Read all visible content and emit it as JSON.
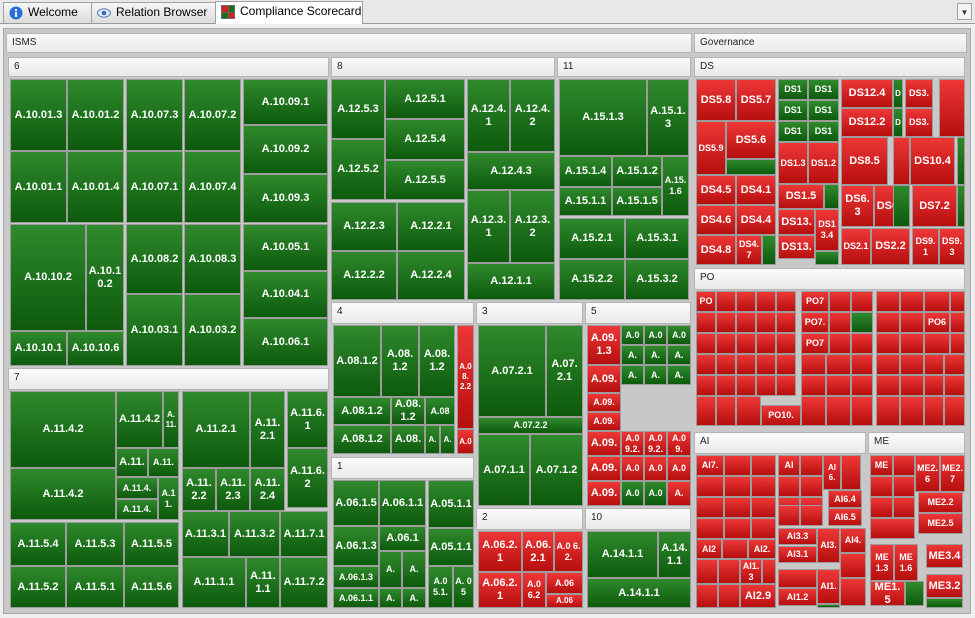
{
  "tabs": [
    {
      "label": "Welcome",
      "icon": "info-icon"
    },
    {
      "label": "Relation Browser",
      "icon": "eye-icon"
    },
    {
      "label": "Compliance Scorecard",
      "icon": "treemap-icon",
      "active": true
    }
  ],
  "colors": {
    "compliant": "#1a6e1a",
    "noncompliant": "#d42020"
  },
  "treemap": {
    "sections": [
      {
        "key": "isms",
        "label": "ISMS"
      },
      {
        "key": "governance",
        "label": "Governance"
      }
    ],
    "groups": {
      "g6": "6",
      "g8": "8",
      "g11": "11",
      "g4": "4",
      "g3": "3",
      "g5": "5",
      "g7": "7",
      "g1": "1",
      "g2": "2",
      "g10": "10",
      "gds": "DS",
      "gpo": "PO",
      "gai": "AI",
      "gme": "ME"
    },
    "cells": {
      "c6_01": "A.10.01.3",
      "c6_02": "A.10.01.2",
      "c6_03": "A.10.07.3",
      "c6_04": "A.10.07.2",
      "c6_05": "A.10.09.1",
      "c6_06": "A.10.01.1",
      "c6_07": "A.10.01.4",
      "c6_08": "A.10.07.1",
      "c6_09": "A.10.07.4",
      "c6_10": "A.10.09.2",
      "c6_11": "A.10.09.3",
      "c6_12": "A.10.10.2",
      "c6_13": "A.10.10.2",
      "c6_14": "A.10.08.2",
      "c6_15": "A.10.08.3",
      "c6_16": "A.10.05.1",
      "c6_17": "A.10.04.1",
      "c6_18": "A.10.10.1",
      "c6_19": "A.10.10.6",
      "c6_20": "A.10.03.1",
      "c6_21": "A.10.03.2",
      "c6_22": "A.10.06.1",
      "c8_01": "A.12.5.3",
      "c8_02": "A.12.5.1",
      "c8_03": "A.12.4.1",
      "c8_04": "A.12.4.2",
      "c8_05": "A.12.5.4",
      "c8_06": "A.12.5.2",
      "c8_07": "A.12.5.5",
      "c8_08": "A.12.4.3",
      "c8_09": "A.12.3.1",
      "c8_10": "A.12.3.2",
      "c8_11": "A.12.2.3",
      "c8_12": "A.12.2.1",
      "c8_13": "A.12.2.2",
      "c8_14": "A.12.2.4",
      "c8_15": "A.12.1.1",
      "c11_01": "A.15.1.3",
      "c11_02": "A.15.1.3",
      "c11_03": "A.15.1.4",
      "c11_04": "A.15.1.2",
      "c11_05": "A.15.1.6",
      "c11_06": "A.15.1.1",
      "c11_07": "A.15.1.5",
      "c11_08": "A.15.2.1",
      "c11_09": "A.15.3.1",
      "c11_10": "A.15.2.2",
      "c11_11": "A.15.3.2",
      "c7_01": "A.11.4.2",
      "c7_02": "A.11.4.2",
      "c7_03": "A.11.",
      "c7_04": "A.11.2.1",
      "c7_05": "A.11.2.1",
      "c7_06": "A.11.6.1",
      "c7_07": "A.11.",
      "c7_08": "A.11.",
      "c7_09": "A.11.4.2",
      "c7_10": "A.11.4.",
      "c7_11": "A.11.",
      "c7_12": "A.11.4.",
      "c7_13": "A.11.2.2",
      "c7_14": "A.11.2.3",
      "c7_15": "A.11.2.4",
      "c7_16": "A.11.6.2",
      "c7_17": "A.11.5.4",
      "c7_18": "A.11.5.3",
      "c7_19": "A.11.5.5",
      "c7_20": "A.11.3.1",
      "c7_21": "A.11.3.2",
      "c7_22": "A.11.7.1",
      "c7_23": "A.11.5.2",
      "c7_24": "A.11.5.1",
      "c7_25": "A.11.5.6",
      "c7_26": "A.11.1.1",
      "c7_27": "A.11.1.1",
      "c7_28": "A.11.7.2",
      "c4_01": "A.08.1.2",
      "c4_02": "A.08.1.2",
      "c4_03": "A.08.1.2",
      "c4_04": "A.08.2.2",
      "c4_05": "A.08.1.2",
      "c4_06": "A.08.1.2",
      "c4_07": "A.08",
      "c4_08": "A.08.1.2",
      "c4_09": "A.08.",
      "c4_10": "A.",
      "c4_11": "A.",
      "c4_12": "A.0",
      "c3_01": "A.07.2.1",
      "c3_02": "A.07.2.1",
      "c3_03": "A.07.2.2",
      "c3_04": "A.07.1.1",
      "c3_05": "A.07.1.2",
      "c5_01": "A.09.1.3",
      "c5_02": "A.0",
      "c5_03": "A.0",
      "c5_04": "A.0",
      "c5_05": "A.09.",
      "c5_06": "A.",
      "c5_07": "A.",
      "c5_08": "A.",
      "c5_09": "A.09.",
      "c5_10": "A.",
      "c5_11": "A.",
      "c5_12": "A.",
      "c5_13": "A.09.",
      "c5_14": "A.09.",
      "c5_15": "A.09.2.",
      "c5_16": "A.09.2.",
      "c5_17": "A.09.",
      "c5_18": "A.09.",
      "c5_19": "A.0",
      "c5_20": "A.0",
      "c5_21": "A.0",
      "c5_22": "A.09.",
      "c5_23": "A.0",
      "c5_24": "A.0",
      "c5_25": "A.",
      "c1_01": "A.06.1.5",
      "c1_02": "A.06.1.1",
      "c1_03": "A.05.1.1",
      "c1_04": "A.06.1.3",
      "c1_05": "A.06.1",
      "c1_06": "A.05.1.1",
      "c1_07": "A.06.1.3",
      "c1_08": "A.",
      "c1_09": "A.",
      "c1_10": "A.06.1.1",
      "c1_11": "A.",
      "c1_12": "A.",
      "c1_13": "A.0 5.1.",
      "c1_14": "A. 05",
      "c2_01": "A.06.2.1",
      "c2_02": "A.06.2.1",
      "c2_03": "A.0 6.2.",
      "c2_04": "A.06.2.1",
      "c2_05": "A.0 6.2",
      "c2_06": "A.06",
      "c2_07": "A.06",
      "c10_01": "A.14.1.1",
      "c10_02": "A.14.1.1",
      "c10_03": "A.14.1.1",
      "ds_01": "DS5.8",
      "ds_02": "DS5.7",
      "ds_03": "DS1",
      "ds_04": "DS1",
      "ds_05": "DS12.4",
      "ds_06": "D",
      "ds_07": "DS3.",
      "ds_08": "DS1",
      "ds_09": "DS1",
      "ds_10": "DS12.2",
      "ds_11": "D",
      "ds_12": "DS3.",
      "ds_13": "DS5.9",
      "ds_14": "DS5.6",
      "ds_15": "DS1",
      "ds_16": "DS1",
      "ds_17": "DS8.5",
      "ds_18": "DS10.4",
      "ds_19": "DS1.3",
      "ds_20": "DS1.2",
      "ds_21": "DS4.5",
      "ds_22": "DS4.1",
      "ds_23": "DS1.5",
      "ds_24": "DS6.3",
      "ds_25": "DS6.4",
      "ds_26": "DS7.2",
      "ds_27": "DS4.6",
      "ds_28": "DS4.4",
      "ds_29": "DS13.",
      "ds_30": "DS13.4",
      "ds_31": "DS4.8",
      "ds_32": "DS4.7",
      "ds_33": "DS13.",
      "ds_34": "DS2.1",
      "ds_35": "DS2.2",
      "ds_36": "DS9.1",
      "ds_37": "DS9.3",
      "po_01": "PO",
      "po_02": "PO7",
      "po_03": "PO7.",
      "po_04": "PO7",
      "po_05": "PO6",
      "po_06": "PO10.",
      "ai_01": "AI7.",
      "ai_02": "AI",
      "ai_03": "AI6.",
      "ai_04": "AI6.4",
      "ai_05": "AI6.5",
      "ai_06": "AI3.",
      "ai_07": "AI3.3",
      "ai_08": "AI3.1",
      "ai_09": "AI4.",
      "ai_10": "AI2",
      "ai_11": "AI2.",
      "ai_12": "AI1.3",
      "ai_13": "AI1.",
      "ai_14": "AI1.2",
      "ai_15": "AI2.9",
      "me_01": "ME",
      "me_02": "ME2.6",
      "me_03": "ME2.7",
      "me_04": "ME2.2",
      "me_05": "ME2.5",
      "me_06": "ME1.3",
      "me_07": "ME1.6",
      "me_08": "ME3.4",
      "me_09": "ME3.2",
      "me_10": "ME1.5"
    }
  }
}
